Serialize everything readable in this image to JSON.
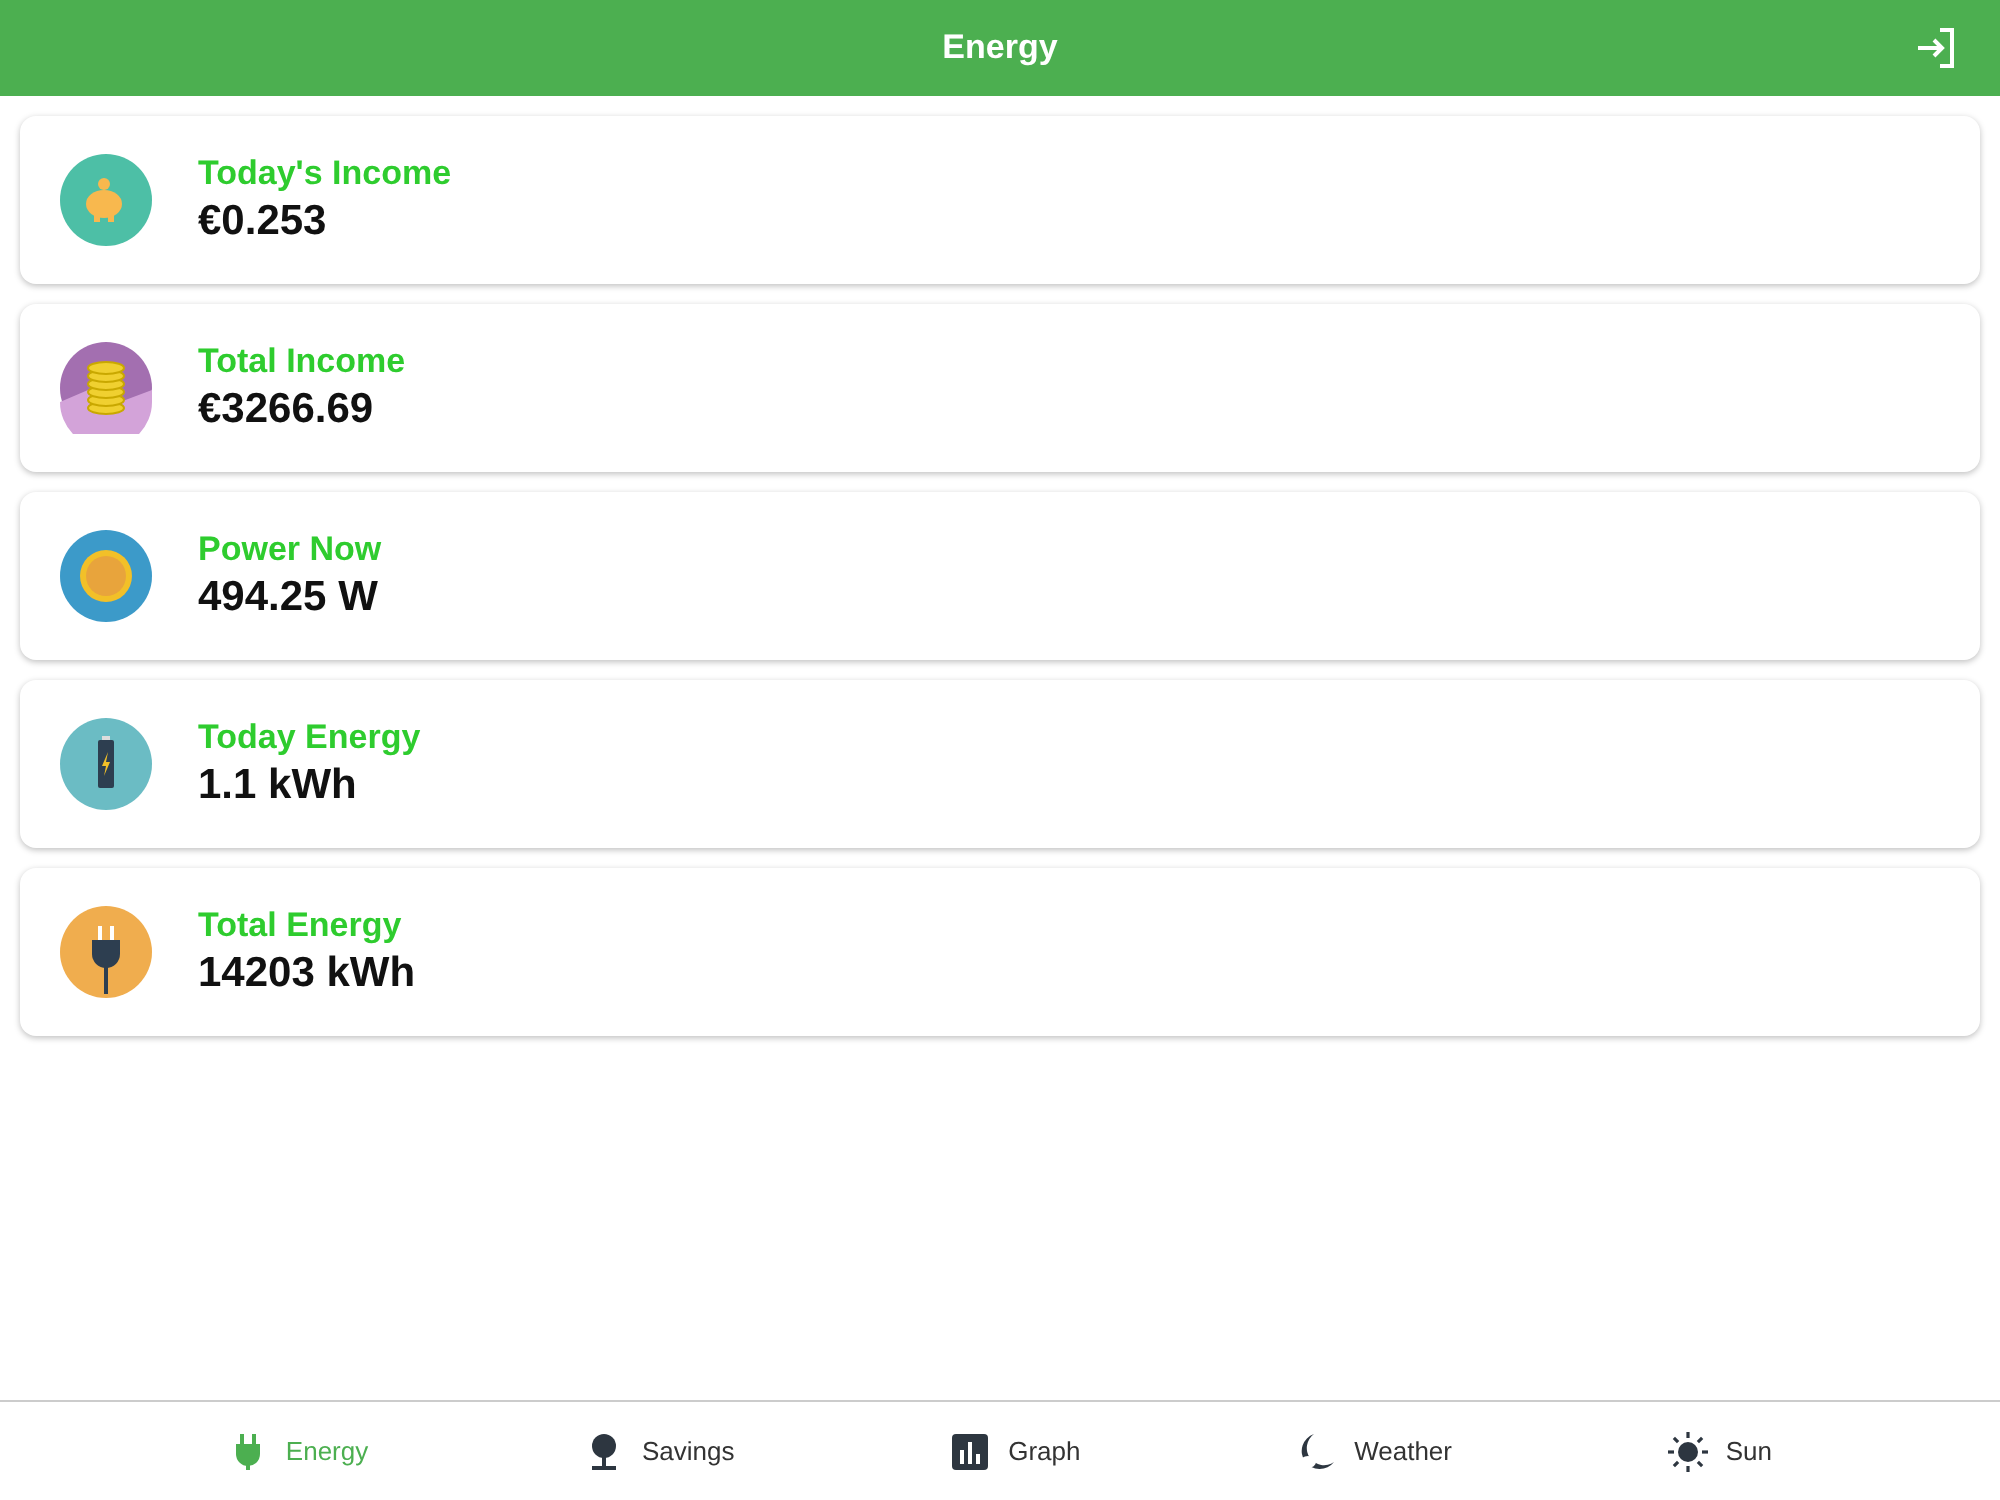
{
  "header": {
    "title": "Energy"
  },
  "cards": [
    {
      "kind": "piggy",
      "label": "Today's Income",
      "value": "€0.253"
    },
    {
      "kind": "coins",
      "label": "Total Income",
      "value": "€3266.69"
    },
    {
      "kind": "sun",
      "label": "Power Now",
      "value": "494.25 W"
    },
    {
      "kind": "battery",
      "label": "Today Energy",
      "value": "1.1 kWh"
    },
    {
      "kind": "plug",
      "label": "Total Energy",
      "value": "14203 kWh"
    }
  ],
  "tabs": [
    {
      "kind": "plug",
      "label": "Energy",
      "selected": true
    },
    {
      "kind": "tree",
      "label": "Savings",
      "selected": false
    },
    {
      "kind": "graph",
      "label": "Graph",
      "selected": false
    },
    {
      "kind": "weather",
      "label": "Weather",
      "selected": false
    },
    {
      "kind": "sun",
      "label": "Sun",
      "selected": false
    }
  ]
}
